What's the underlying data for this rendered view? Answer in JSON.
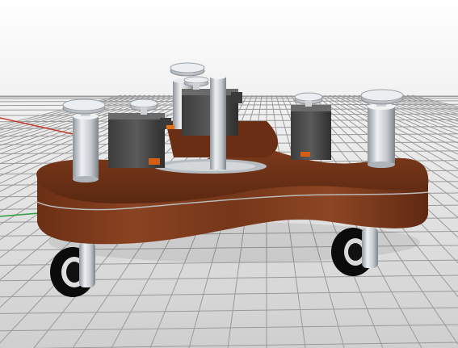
{
  "viewport": {
    "background_top": "#ffffff",
    "background_bottom": "#d0d0d0",
    "grid_color": "#9a9a9a",
    "axis_x_color": "#c0392b",
    "axis_y_color": "#2e9b3f"
  },
  "model": {
    "body_color": "#7a3a1c",
    "body_dark": "#4e2210",
    "post_color": "#d9dde0",
    "servo_color": "#4a4a4a",
    "wheel_color": "#0a0a0a",
    "accent_color": "#e0701a"
  }
}
